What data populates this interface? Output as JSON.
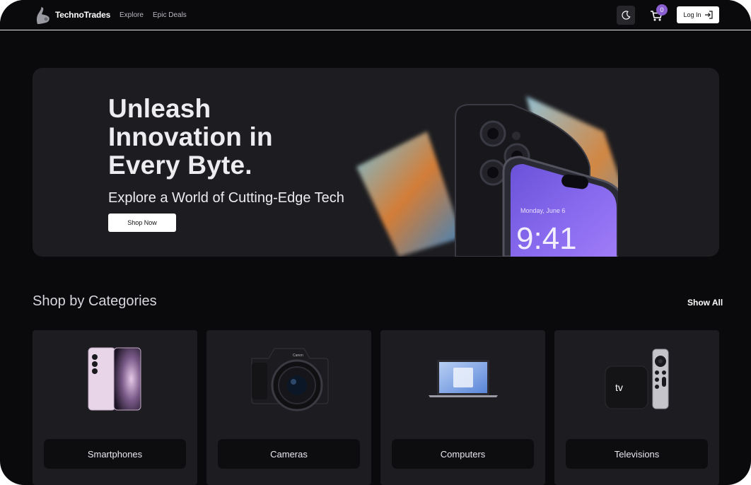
{
  "header": {
    "brand": "TechnoTrades",
    "nav_links": [
      "Explore",
      "Epic Deals"
    ],
    "cart_count": "0",
    "login_label": "Log In",
    "icons": [
      "logo-icon",
      "moon-icon",
      "cart-icon",
      "login-arrow-icon"
    ]
  },
  "hero": {
    "title": "Unleash Innovation in Every Byte.",
    "subtitle": "Explore a World of Cutting-Edge Tech",
    "cta_label": "Shop Now",
    "phone_date": "Monday, June 6",
    "phone_time": "9:41"
  },
  "categories": {
    "title": "Shop by Categories",
    "show_all_label": "Show All",
    "items": [
      {
        "label": "Smartphones"
      },
      {
        "label": "Cameras"
      },
      {
        "label": "Computers"
      },
      {
        "label": "Televisions"
      }
    ],
    "tv_logo_text": "tv"
  },
  "colors": {
    "background": "#0a0a0c",
    "card": "#1d1d21",
    "accent_badge": "#8a5fd1",
    "text": "#ededf0"
  }
}
